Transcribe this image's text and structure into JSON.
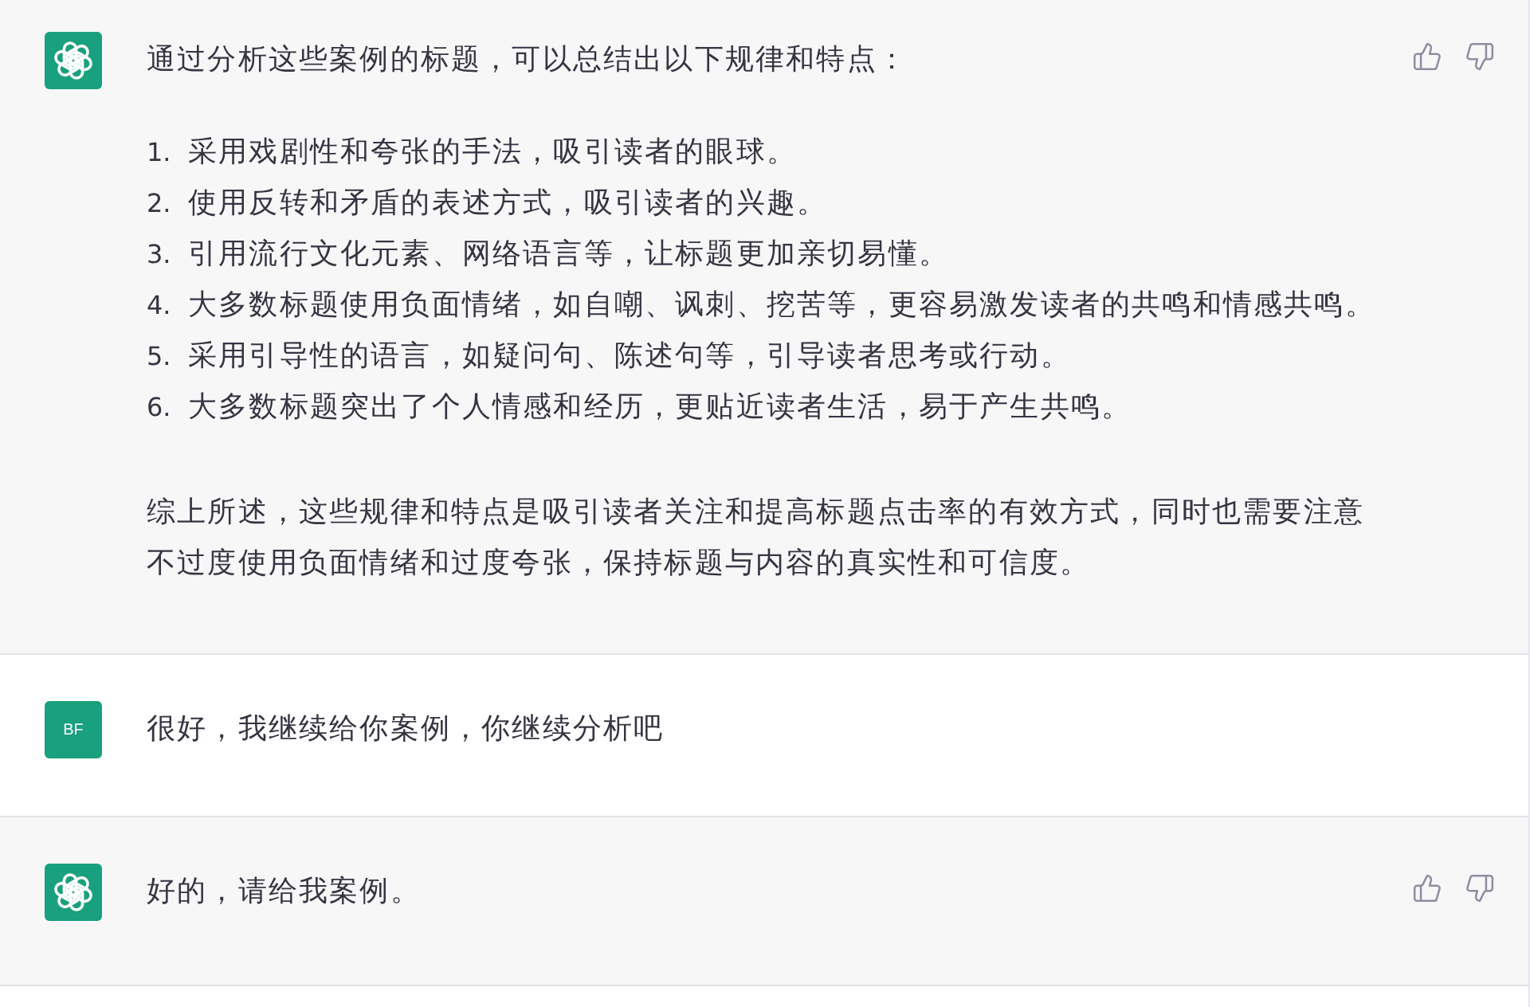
{
  "messages": [
    {
      "kind": "assistant",
      "blocks": [
        {
          "kind": "paragraph",
          "text": "通过分析这些案例的标题，可以总结出以下规律和特点："
        },
        {
          "kind": "list",
          "items": [
            {
              "number": "1.",
              "text": "采用戏剧性和夸张的手法，吸引读者的眼球。"
            },
            {
              "number": "2.",
              "text": "使用反转和矛盾的表述方式，吸引读者的兴趣。"
            },
            {
              "number": "3.",
              "text": "引用流行文化元素、网络语言等，让标题更加亲切易懂。"
            },
            {
              "number": "4.",
              "text": "大多数标题使用负面情绪，如自嘲、讽刺、挖苦等，更容易激发读者的共鸣和情感共鸣。"
            },
            {
              "number": "5.",
              "text": "采用引导性的语言，如疑问句、陈述句等，引导读者思考或行动。"
            },
            {
              "number": "6.",
              "text": "大多数标题突出了个人情感和经历，更贴近读者生活，易于产生共鸣。"
            }
          ]
        },
        {
          "kind": "paragraph",
          "text": "综上所述，这些规律和特点是吸引读者关注和提高标题点击率的有效方式，同时也需要注意不过度使用负面情绪和过度夸张，保持标题与内容的真实性和可信度。"
        }
      ]
    },
    {
      "kind": "user",
      "avatar": "BF",
      "blocks": [
        {
          "kind": "paragraph",
          "text": "很好，我继续给你案例，你继续分析吧"
        }
      ]
    },
    {
      "kind": "assistant",
      "blocks": [
        {
          "kind": "paragraph",
          "text": "好的，请给我案例。"
        }
      ]
    }
  ]
}
